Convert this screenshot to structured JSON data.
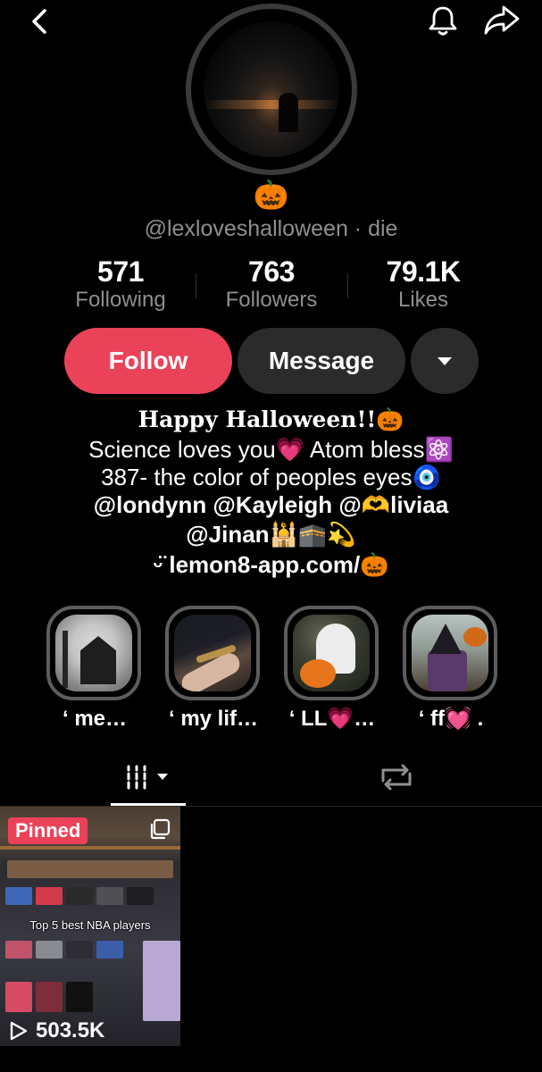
{
  "profile": {
    "emoji": "🎃",
    "username": "@lexloveshalloween · die"
  },
  "stats": {
    "following": {
      "value": "571",
      "label": "Following"
    },
    "followers": {
      "value": "763",
      "label": "Followers"
    },
    "likes": {
      "value": "79.1K",
      "label": "Likes"
    }
  },
  "actions": {
    "follow_label": "Follow",
    "message_label": "Message"
  },
  "bio": {
    "line1": "Happy Halloween!!🎃",
    "line2": "Science loves you💗 Atom bless⚛️",
    "line3": "387- the color of peoples eyes🧿",
    "line4": "@londynn  @Kayleigh @🫶liviaa",
    "line5": "@Jinan🕌🕋💫",
    "link": "ᵕ̈ lemon8-app.com/🎃"
  },
  "highlights": [
    {
      "label": "‘ me…"
    },
    {
      "label": "‘ my lif…"
    },
    {
      "label": "‘ LL💗…"
    },
    {
      "label": "‘ ff💓 ."
    }
  ],
  "videos": [
    {
      "badge": "Pinned",
      "caption": "Top 5 best NBA players",
      "views": "503.5K"
    }
  ],
  "colors": {
    "background": "#000000",
    "accent": "#ea4359",
    "secondary_button": "#2b2b2b",
    "muted_text": "#8f8f8f"
  },
  "icons": {
    "back": "chevron-left-icon",
    "notifications": "bell-icon",
    "share": "share-arrow-icon",
    "more": "caret-down-icon",
    "videos_tab": "grid-bars-icon",
    "reposts_tab": "repost-icon",
    "play": "play-outline-icon",
    "multi": "copy-icon"
  }
}
